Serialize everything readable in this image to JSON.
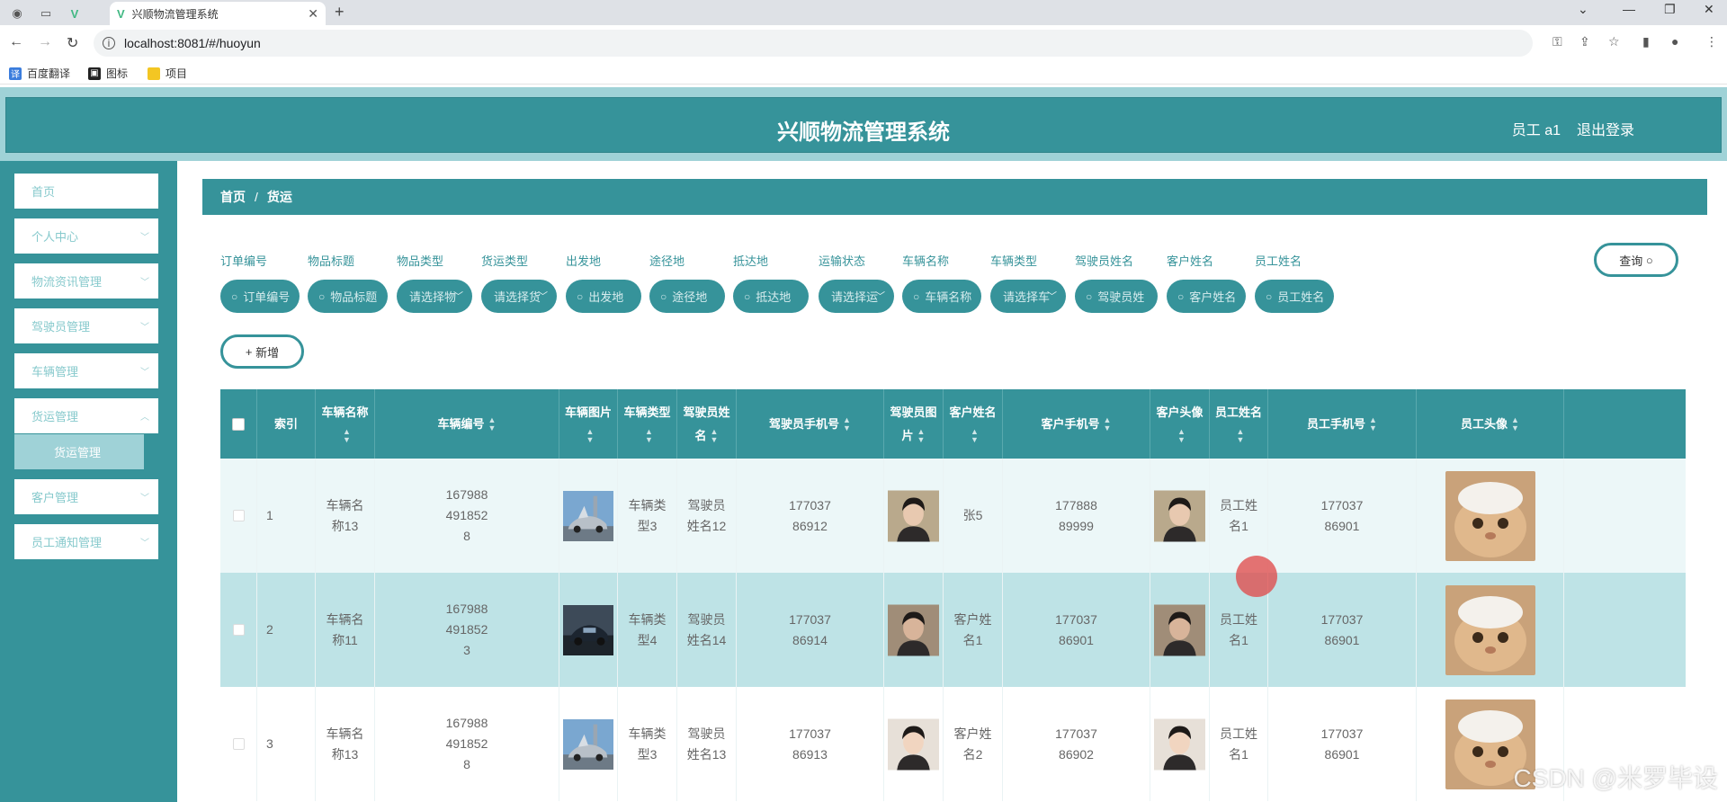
{
  "browser": {
    "tab_title": "兴顺物流管理系统",
    "url": "localhost:8081/#/huoyun",
    "bookmarks": [
      "百度翻译",
      "图标",
      "项目"
    ]
  },
  "header": {
    "title": "兴顺物流管理系统",
    "user": "员工 a1",
    "logout": "退出登录"
  },
  "sidebar": {
    "items": [
      "首页",
      "个人中心",
      "物流资讯管理",
      "驾驶员管理",
      "车辆管理",
      "货运管理",
      "客户管理",
      "员工通知管理"
    ],
    "active_sub": "货运管理"
  },
  "breadcrumb": {
    "home": "首页",
    "separator": "/",
    "current": "货运"
  },
  "filters": [
    {
      "label": "订单编号",
      "placeholder": "订单编号",
      "type": "search"
    },
    {
      "label": "物品标题",
      "placeholder": "物品标题",
      "type": "search"
    },
    {
      "label": "物品类型",
      "placeholder": "请选择物",
      "type": "select"
    },
    {
      "label": "货运类型",
      "placeholder": "请选择货",
      "type": "select"
    },
    {
      "label": "出发地",
      "placeholder": "出发地",
      "type": "search"
    },
    {
      "label": "途径地",
      "placeholder": "途径地",
      "type": "search"
    },
    {
      "label": "抵达地",
      "placeholder": "抵达地",
      "type": "search"
    },
    {
      "label": "运输状态",
      "placeholder": "请选择运",
      "type": "select"
    },
    {
      "label": "车辆名称",
      "placeholder": "车辆名称",
      "type": "search"
    },
    {
      "label": "车辆类型",
      "placeholder": "请选择车",
      "type": "select"
    },
    {
      "label": "驾驶员姓名",
      "placeholder": "驾驶员姓",
      "type": "search"
    },
    {
      "label": "客户姓名",
      "placeholder": "客户姓名",
      "type": "search"
    },
    {
      "label": "员工姓名",
      "placeholder": "员工姓名",
      "type": "search"
    }
  ],
  "buttons": {
    "query": "查询",
    "add": "新增"
  },
  "table": {
    "columns": [
      "索引",
      "车辆名称",
      "车辆编号",
      "车辆图片",
      "车辆类型",
      "驾驶员姓名",
      "驾驶员手机号",
      "驾驶员图片",
      "客户姓名",
      "客户手机号",
      "客户头像",
      "员工姓名",
      "员工手机号",
      "员工头像"
    ],
    "rows": [
      [
        "1",
        "车辆名称13",
        "1679884918528",
        "",
        "车辆类型3",
        "驾驶员姓名12",
        "17703786912",
        "",
        "张5",
        "17788889999",
        "",
        "员工姓名1",
        "17703786901",
        ""
      ],
      [
        "2",
        "车辆名称11",
        "1679884918523",
        "",
        "车辆类型4",
        "驾驶员姓名14",
        "17703786914",
        "",
        "客户姓名1",
        "17703786901",
        "",
        "员工姓名1",
        "17703786901",
        ""
      ],
      [
        "3",
        "车辆名称13",
        "1679884918528",
        "",
        "车辆类型3",
        "驾驶员姓名13",
        "17703786913",
        "",
        "客户姓名2",
        "17703786902",
        "",
        "员工姓名1",
        "17703786901",
        ""
      ]
    ]
  },
  "watermark": "CSDN @米罗毕设",
  "colors": {
    "primary": "#36939a",
    "light": "#9fd2d7",
    "row_alt": "#bee3e6",
    "row_first": "#ecf7f8"
  }
}
